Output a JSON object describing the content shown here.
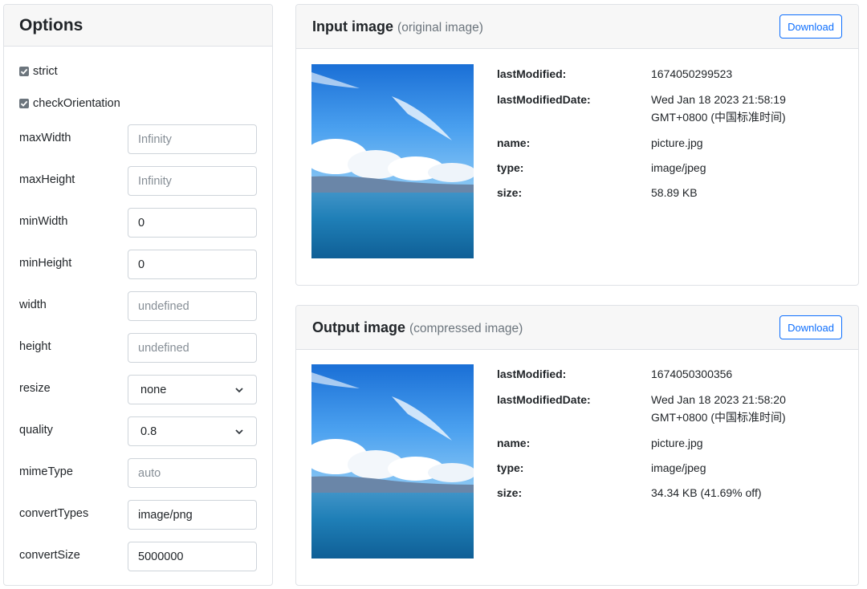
{
  "options": {
    "title": "Options",
    "checks": [
      {
        "label": "strict",
        "checked": true
      },
      {
        "label": "checkOrientation",
        "checked": true
      }
    ],
    "fields": [
      {
        "label": "maxWidth",
        "kind": "input",
        "value": "",
        "placeholder": "Infinity"
      },
      {
        "label": "maxHeight",
        "kind": "input",
        "value": "",
        "placeholder": "Infinity"
      },
      {
        "label": "minWidth",
        "kind": "input",
        "value": "0",
        "placeholder": ""
      },
      {
        "label": "minHeight",
        "kind": "input",
        "value": "0",
        "placeholder": ""
      },
      {
        "label": "width",
        "kind": "input",
        "value": "",
        "placeholder": "undefined"
      },
      {
        "label": "height",
        "kind": "input",
        "value": "",
        "placeholder": "undefined"
      },
      {
        "label": "resize",
        "kind": "select",
        "value": "none"
      },
      {
        "label": "quality",
        "kind": "select",
        "value": "0.8"
      },
      {
        "label": "mimeType",
        "kind": "input",
        "value": "",
        "placeholder": "auto"
      },
      {
        "label": "convertTypes",
        "kind": "input",
        "value": "image/png",
        "placeholder": ""
      },
      {
        "label": "convertSize",
        "kind": "input",
        "value": "5000000",
        "placeholder": ""
      }
    ]
  },
  "input_card": {
    "title": "Input image",
    "subtitle": "(original image)",
    "download_label": "Download",
    "meta": [
      {
        "key": "lastModified:",
        "value": "1674050299523"
      },
      {
        "key": "lastModifiedDate:",
        "value": "Wed Jan 18 2023 21:58:19 GMT+0800 (中国标准时间)"
      },
      {
        "key": "name:",
        "value": "picture.jpg"
      },
      {
        "key": "type:",
        "value": "image/jpeg"
      },
      {
        "key": "size:",
        "value": "58.89 KB"
      }
    ]
  },
  "output_card": {
    "title": "Output image",
    "subtitle": "(compressed image)",
    "download_label": "Download",
    "meta": [
      {
        "key": "lastModified:",
        "value": "1674050300356"
      },
      {
        "key": "lastModifiedDate:",
        "value": "Wed Jan 18 2023 21:58:20 GMT+0800 (中国标准时间)"
      },
      {
        "key": "name:",
        "value": "picture.jpg"
      },
      {
        "key": "type:",
        "value": "image/jpeg"
      },
      {
        "key": "size:",
        "value": "34.34 KB (41.69% off)"
      }
    ]
  },
  "colors": {
    "accent": "#0d6efd",
    "checkbox": "#6c757d",
    "muted_text": "#6c757d"
  }
}
